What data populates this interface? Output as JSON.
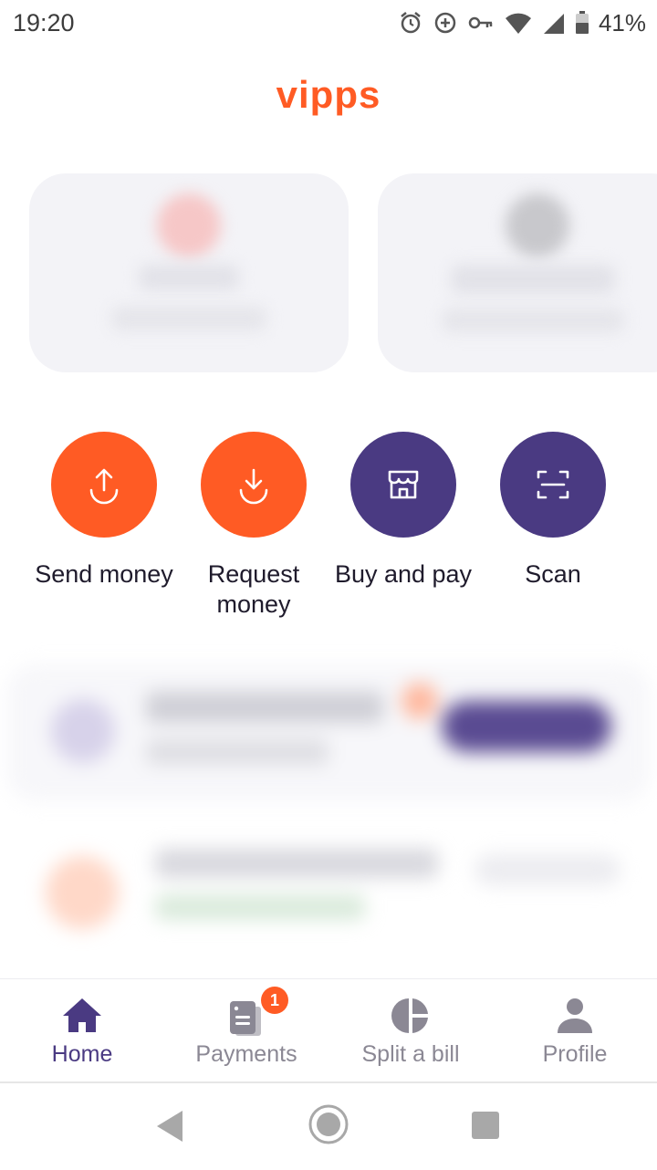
{
  "status_bar": {
    "time": "19:20",
    "battery": "41%"
  },
  "brand": {
    "logo_text": "vipps",
    "accent": "#ff5b24",
    "primary": "#4a3a82"
  },
  "actions": [
    {
      "label": "Send money",
      "icon": "send-money-icon",
      "color": "#ff5b24"
    },
    {
      "label": "Request money",
      "icon": "request-money-icon",
      "color": "#ff5b24"
    },
    {
      "label": "Buy and pay",
      "icon": "shop-icon",
      "color": "#4a3a82"
    },
    {
      "label": "Scan",
      "icon": "scan-icon",
      "color": "#4a3a82"
    }
  ],
  "bottom_nav": {
    "items": [
      {
        "label": "Home",
        "icon": "home-icon",
        "active": true
      },
      {
        "label": "Payments",
        "icon": "payments-icon",
        "badge": "1"
      },
      {
        "label": "Split a bill",
        "icon": "pie-chart-icon"
      },
      {
        "label": "Profile",
        "icon": "profile-icon"
      }
    ]
  },
  "system_nav": {
    "icons": [
      "back-icon",
      "home-circle-icon",
      "recents-icon"
    ]
  }
}
